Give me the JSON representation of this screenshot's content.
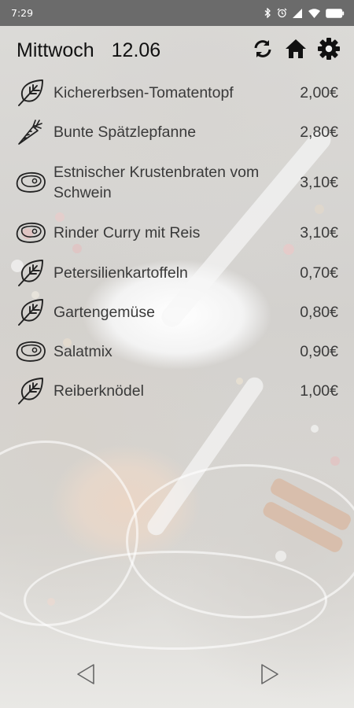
{
  "status_bar": {
    "time": "7:29",
    "icons": [
      "bluetooth-icon",
      "alarm-icon",
      "signal-icon",
      "wifi-icon",
      "battery-icon"
    ]
  },
  "header": {
    "day": "Mittwoch",
    "date": "12.06",
    "actions": [
      "refresh-icon",
      "home-icon",
      "settings-icon"
    ]
  },
  "menu": [
    {
      "name": "Kichererbsen-Tomatentopf",
      "price": "2,00€",
      "icon": "leaf-icon"
    },
    {
      "name": "Bunte Spätzlepfanne",
      "price": "2,80€",
      "icon": "carrot-icon"
    },
    {
      "name": "Estnischer Krustenbraten vom Schwein",
      "price": "3,10€",
      "icon": "meat-icon"
    },
    {
      "name": "Rinder Curry mit Reis",
      "price": "3,10€",
      "icon": "meat-icon"
    },
    {
      "name": "Petersilienkartoffeln",
      "price": "0,70€",
      "icon": "leaf-icon"
    },
    {
      "name": "Gartengemüse",
      "price": "0,80€",
      "icon": "leaf-icon"
    },
    {
      "name": "Salatmix",
      "price": "0,90€",
      "icon": "meat-icon"
    },
    {
      "name": "Reiberknödel",
      "price": "1,00€",
      "icon": "leaf-icon"
    }
  ],
  "navigation": {
    "previous": "previous-day-icon",
    "next": "next-day-icon"
  },
  "colors": {
    "status_bar": "#6b6b6b",
    "text": "#3a3a3a",
    "header_text": "#111111"
  }
}
